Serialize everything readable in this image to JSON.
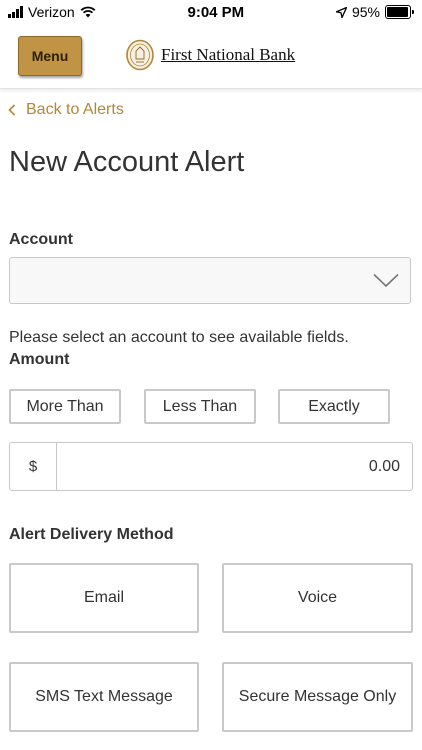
{
  "status_bar": {
    "carrier": "Verizon",
    "time": "9:04 PM",
    "battery": "95%",
    "battery_level": 0.95
  },
  "header": {
    "menu_label": "Menu",
    "bank_name": "First National Bank"
  },
  "nav": {
    "back_label": "Back to Alerts"
  },
  "page": {
    "title": "New Account Alert"
  },
  "account": {
    "label": "Account",
    "selected": "",
    "help_text": "Please select an account to see available fields."
  },
  "amount": {
    "label": "Amount",
    "options": [
      "More Than",
      "Less Than",
      "Exactly"
    ],
    "currency_symbol": "$",
    "placeholder": "0.00"
  },
  "delivery": {
    "label": "Alert Delivery Method",
    "options": [
      "Email",
      "Voice",
      "SMS Text Message",
      "Secure Message Only"
    ]
  },
  "colors": {
    "accent": "#b08838",
    "menu_button": "#c09444",
    "border": "#c9c9c9"
  }
}
